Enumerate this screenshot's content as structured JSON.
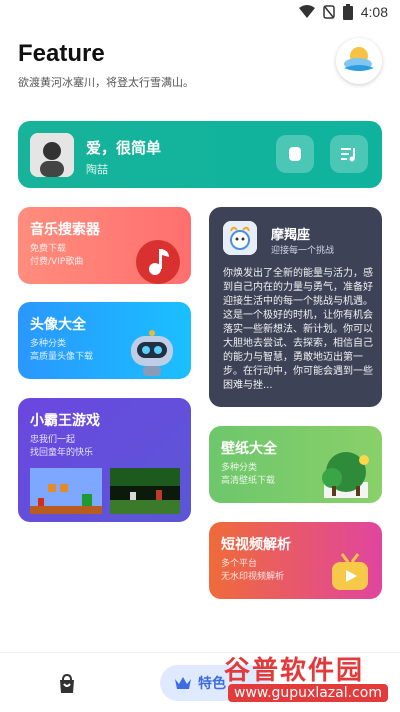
{
  "status": {
    "time": "4:08"
  },
  "header": {
    "title": "Feature",
    "subtitle": "欲渡黄河冰塞川，将登太行雪满山。"
  },
  "player": {
    "song": "爱，很简单",
    "artist": "陶喆"
  },
  "cards": {
    "music": {
      "title": "音乐搜索器",
      "sub1": "免费下载",
      "sub2": "付费/VIP歌曲"
    },
    "avatar": {
      "title": "头像大全",
      "sub1": "多种分类",
      "sub2": "高质量头像下载"
    },
    "game": {
      "title": "小霸王游戏",
      "sub1": "忠我们一起",
      "sub2": "找回童年的快乐"
    },
    "zodiac": {
      "name": "摩羯座",
      "slogan": "迎接每一个挑战",
      "text": "你焕发出了全新的能量与活力，感到自己内在的力量与勇气，准备好迎接生活中的每一个挑战与机遇。这是一个极好的时机，让你有机会落实一些新想法、新计划。你可以大胆地去尝试、去探索，相信自己的能力与智慧，勇敢地迈出第一步。在行动中，你可能会遇到一些困难与挫..."
    },
    "wallpaper": {
      "title": "壁纸大全",
      "sub1": "多种分类",
      "sub2": "高清壁纸下载"
    },
    "video": {
      "title": "短视频解析",
      "sub1": "多个平台",
      "sub2": "无水印视频解析"
    }
  },
  "bottom": {
    "tab_feature": "特色"
  },
  "watermark": {
    "title": "谷普软件园",
    "url": "www.gupuxlazal.com"
  }
}
